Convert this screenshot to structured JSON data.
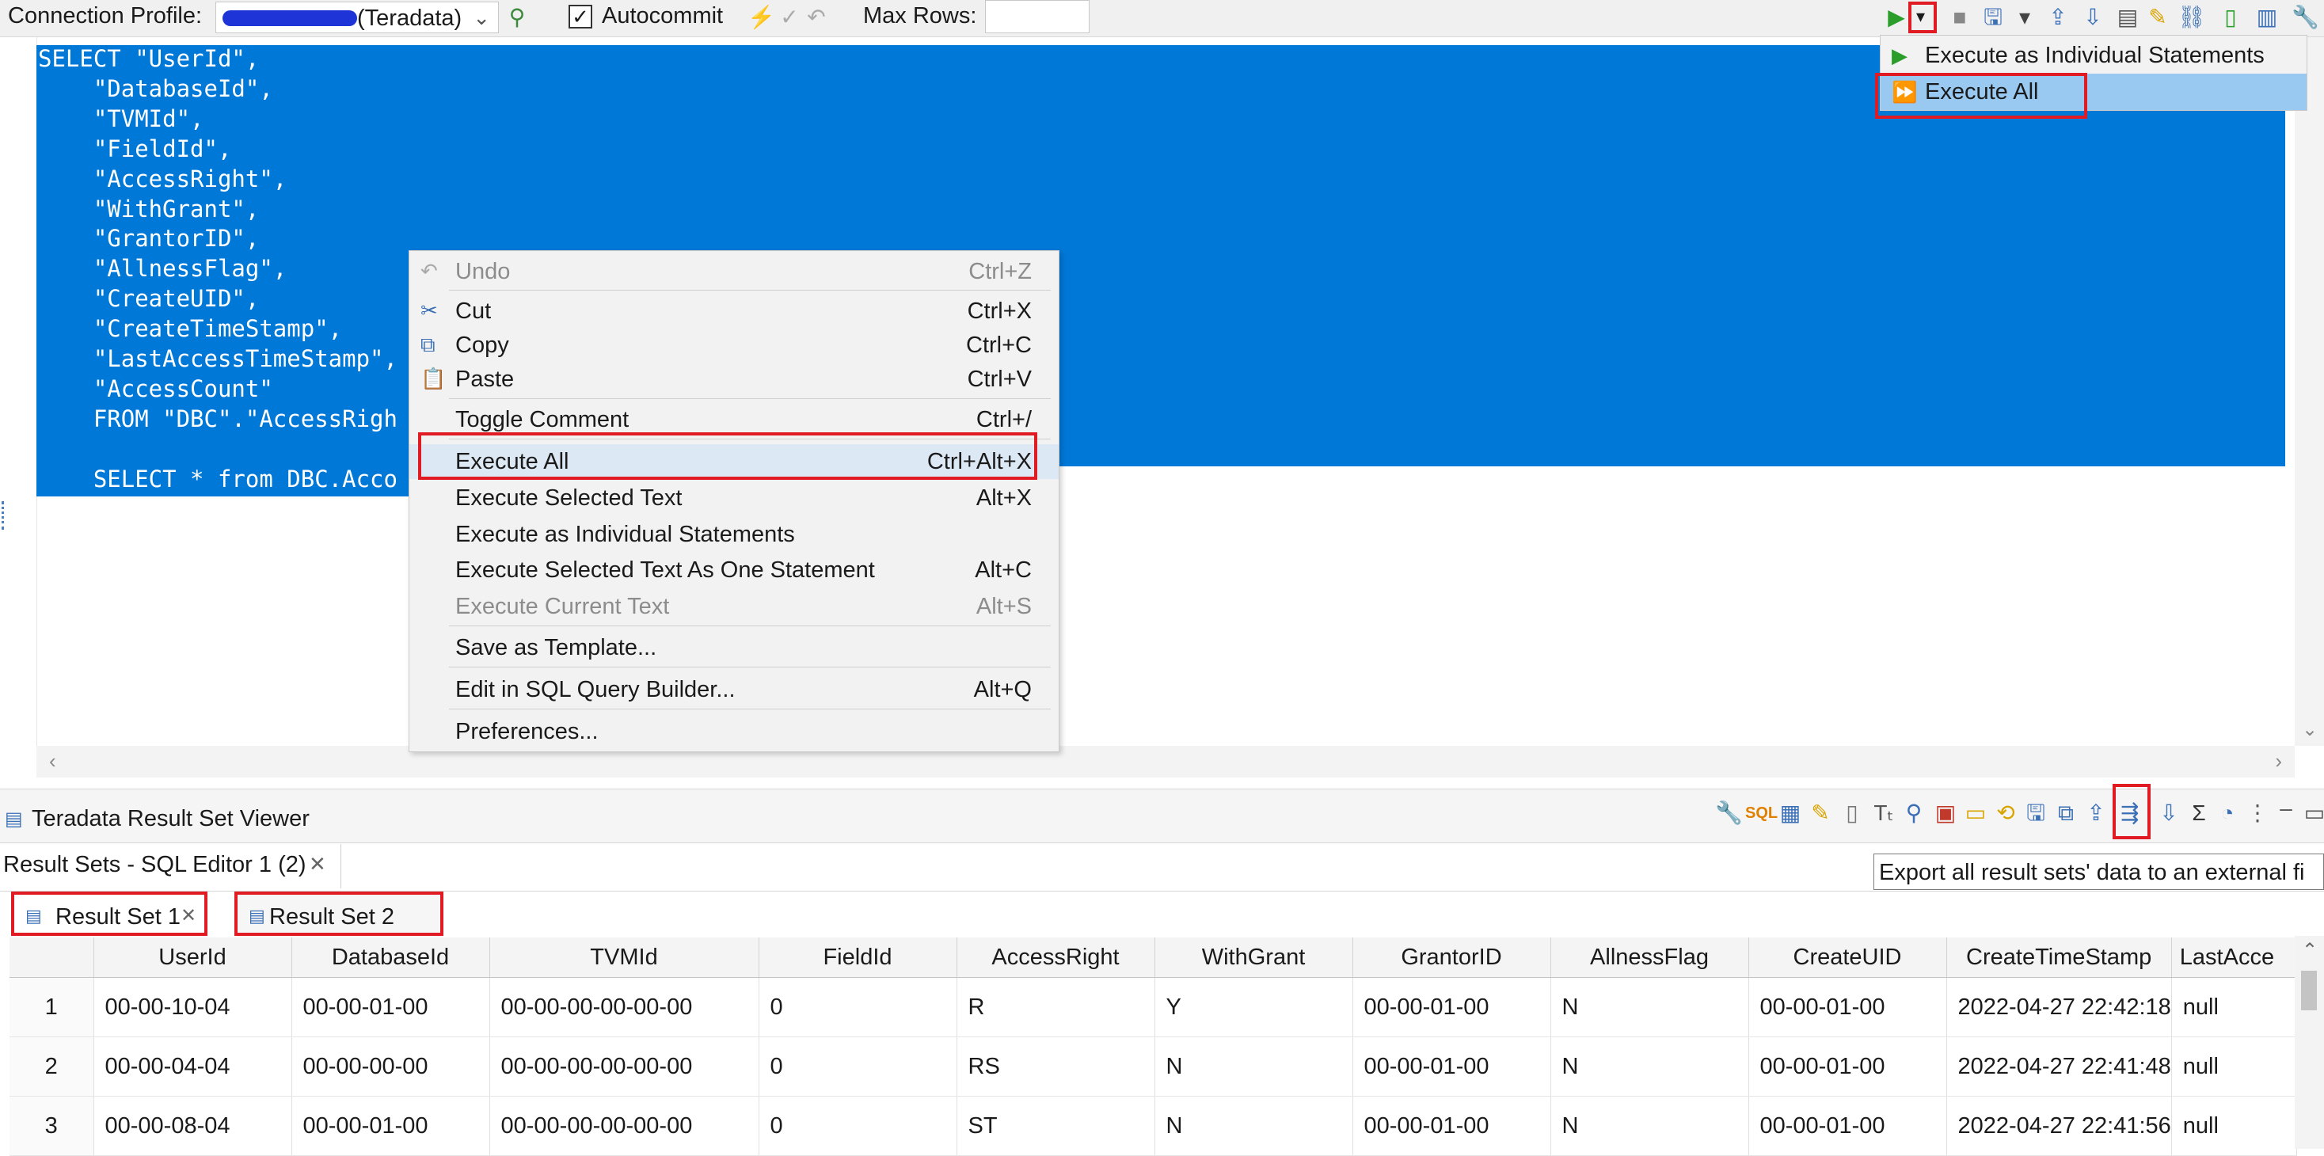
{
  "toolbar": {
    "connection_profile_label": "Connection Profile:",
    "connection_profile_value": "(Teradata)",
    "autocommit_label": "Autocommit",
    "autocommit_checked": "✓",
    "max_rows_label": "Max Rows:",
    "max_rows_value": ""
  },
  "editor": {
    "sql_text": "SELECT \"UserId\",\n    \"DatabaseId\",\n    \"TVMId\",\n    \"FieldId\",\n    \"AccessRight\",\n    \"WithGrant\",\n    \"GrantorID\",\n    \"AllnessFlag\",\n    \"CreateUID\",\n    \"CreateTimeStamp\",\n    \"LastAccessTimeStamp\",\n    \"AccessCount\"\n    FROM \"DBC\".\"AccessRigh\n\n    SELECT * from DBC.Acco"
  },
  "execute_dropdown": {
    "items": [
      {
        "label": "Execute as Individual Statements",
        "icon": "run-icon"
      },
      {
        "label": "Execute All",
        "icon": "run-all-icon"
      }
    ]
  },
  "context_menu": {
    "items": [
      {
        "label": "Undo",
        "shortcut": "Ctrl+Z",
        "enabled": "false",
        "icon": "undo-icon"
      },
      {
        "label": "Cut",
        "shortcut": "Ctrl+X",
        "enabled": "true",
        "icon": "scissors-icon"
      },
      {
        "label": "Copy",
        "shortcut": "Ctrl+C",
        "enabled": "true",
        "icon": "copy-icon"
      },
      {
        "label": "Paste",
        "shortcut": "Ctrl+V",
        "enabled": "true",
        "icon": "paste-icon"
      },
      {
        "label": "Toggle Comment",
        "shortcut": "Ctrl+/",
        "enabled": "true"
      },
      {
        "label": "Execute All",
        "shortcut": "Ctrl+Alt+X",
        "enabled": "true"
      },
      {
        "label": "Execute Selected Text",
        "shortcut": "Alt+X",
        "enabled": "true"
      },
      {
        "label": "Execute as Individual Statements",
        "shortcut": "",
        "enabled": "true"
      },
      {
        "label": "Execute Selected Text As One Statement",
        "shortcut": "Alt+C",
        "enabled": "true"
      },
      {
        "label": "Execute Current Text",
        "shortcut": "Alt+S",
        "enabled": "false"
      },
      {
        "label": "Save as Template...",
        "shortcut": "",
        "enabled": "true"
      },
      {
        "label": "Edit in SQL Query Builder...",
        "shortcut": "Alt+Q",
        "enabled": "true"
      },
      {
        "label": "Preferences...",
        "shortcut": "",
        "enabled": "true"
      }
    ]
  },
  "result_viewer": {
    "title": "Teradata Result Set Viewer",
    "tab_label": "Result Sets - SQL Editor 1 (2)",
    "tooltip": "Export all result sets' data to an external fi",
    "subtabs": [
      {
        "label": "Result Set 1"
      },
      {
        "label": "Result Set 2"
      }
    ],
    "columns": [
      "UserId",
      "DatabaseId",
      "TVMId",
      "FieldId",
      "AccessRight",
      "WithGrant",
      "GrantorID",
      "AllnessFlag",
      "CreateUID",
      "CreateTimeStamp",
      "LastAcce"
    ],
    "rows": [
      {
        "n": "1",
        "cells": [
          "00-00-10-04",
          "00-00-01-00",
          "00-00-00-00-00-00",
          "0",
          "R",
          "Y",
          "00-00-01-00",
          "N",
          "00-00-01-00",
          "2022-04-27 22:42:18",
          "null"
        ]
      },
      {
        "n": "2",
        "cells": [
          "00-00-04-04",
          "00-00-00-00",
          "00-00-00-00-00-00",
          "0",
          "RS",
          "N",
          "00-00-01-00",
          "N",
          "00-00-01-00",
          "2022-04-27 22:41:48",
          "null"
        ]
      },
      {
        "n": "3",
        "cells": [
          "00-00-08-04",
          "00-00-01-00",
          "00-00-00-00-00-00",
          "0",
          "ST",
          "N",
          "00-00-01-00",
          "N",
          "00-00-01-00",
          "2022-04-27 22:41:56",
          "null"
        ]
      }
    ]
  },
  "colors": {
    "selection": "#0078d7",
    "highlight_box": "#e01b24",
    "menu_bg": "#f2f2f2",
    "dropdown_highlight": "#99c9f0"
  }
}
